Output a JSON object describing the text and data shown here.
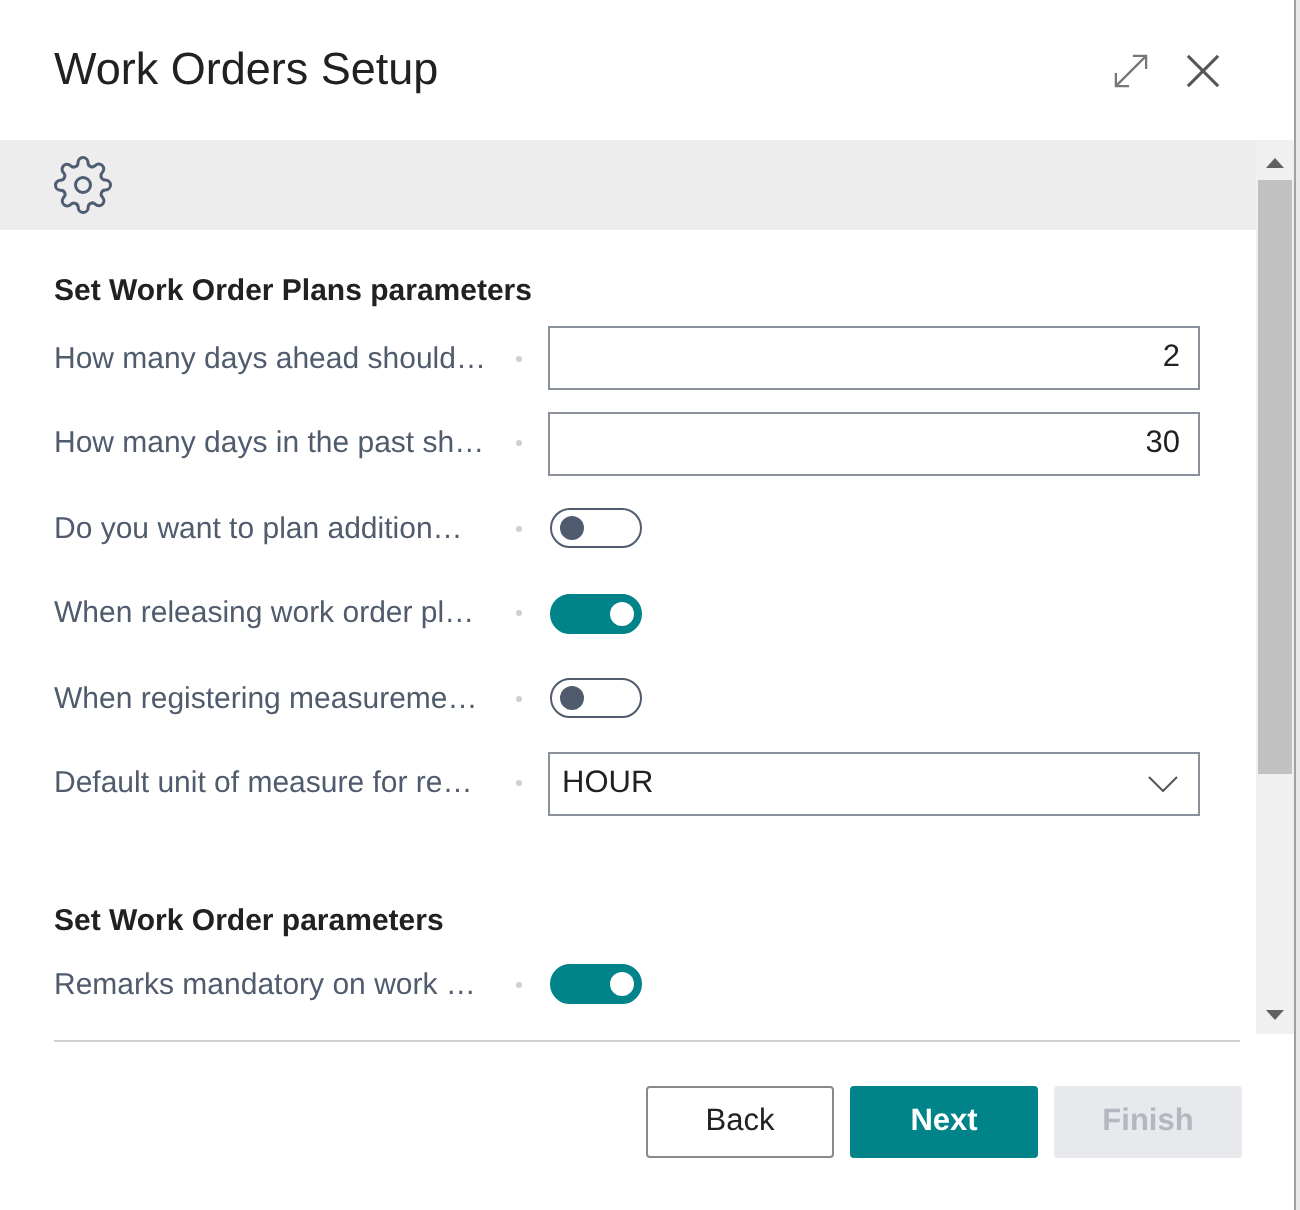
{
  "dialog": {
    "title": "Work Orders Setup"
  },
  "sections": [
    {
      "heading": "Set Work Order Plans parameters",
      "fields": [
        {
          "kind": "number",
          "label": "How many days ahead should…",
          "value": "2"
        },
        {
          "kind": "number",
          "label": "How many days in the past sh…",
          "value": "30"
        },
        {
          "kind": "toggle",
          "label": "Do you want to plan addition…",
          "on": false
        },
        {
          "kind": "toggle",
          "label": "When releasing work order pl…",
          "on": true
        },
        {
          "kind": "toggle",
          "label": "When registering measureme…",
          "on": false
        },
        {
          "kind": "dropdown",
          "label": "Default unit of measure for re…",
          "value": "HOUR"
        }
      ]
    },
    {
      "heading": "Set Work Order parameters",
      "fields": [
        {
          "kind": "toggle",
          "label": "Remarks mandatory on work …",
          "on": true
        }
      ]
    }
  ],
  "buttons": [
    {
      "label": "Back",
      "kind": "default",
      "disabled": false
    },
    {
      "label": "Next",
      "kind": "primary",
      "disabled": false
    },
    {
      "label": "Finish",
      "kind": "default",
      "disabled": true
    }
  ]
}
